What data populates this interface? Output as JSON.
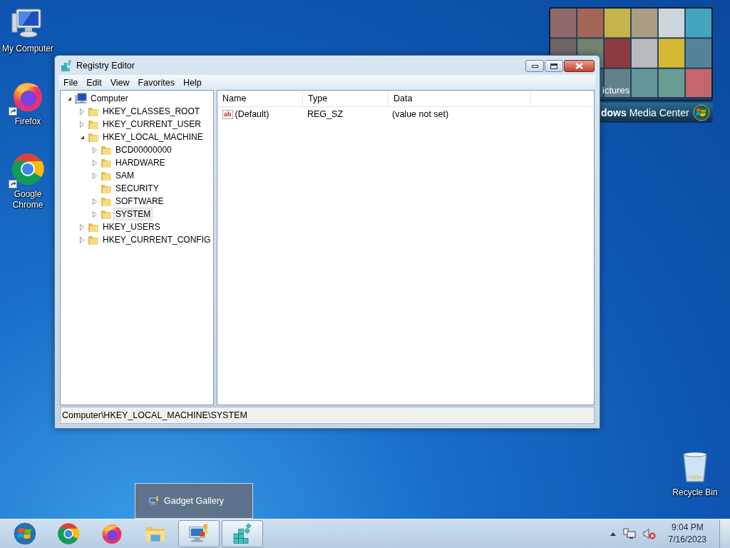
{
  "desktop_icons": [
    {
      "label": "My Computer",
      "kind": "computer",
      "shortcut": false
    },
    {
      "label": "Firefox",
      "kind": "firefox",
      "shortcut": true
    },
    {
      "label": "Google Chrome",
      "kind": "chrome",
      "shortcut": true
    },
    {
      "label": "Recycle Bin",
      "kind": "recycle",
      "shortcut": false
    }
  ],
  "media_center": {
    "caption": "ictures",
    "title": "**dows** Media Center"
  },
  "window": {
    "title": "Registry Editor",
    "menu": [
      "File",
      "Edit",
      "View",
      "Favorites",
      "Help"
    ],
    "tree": [
      {
        "label": "Computer",
        "kind": "computer",
        "expandable": true,
        "expanded": true,
        "selected": false,
        "children": [
          {
            "label": "HKEY_CLASSES_ROOT",
            "kind": "folder",
            "expandable": true,
            "expanded": false,
            "selected": false
          },
          {
            "label": "HKEY_CURRENT_USER",
            "kind": "folder",
            "expandable": true,
            "expanded": false,
            "selected": false
          },
          {
            "label": "HKEY_LOCAL_MACHINE",
            "kind": "folder",
            "expandable": true,
            "expanded": true,
            "selected": false,
            "children": [
              {
                "label": "BCD00000000",
                "kind": "folder",
                "expandable": true,
                "expanded": false,
                "selected": false
              },
              {
                "label": "HARDWARE",
                "kind": "folder",
                "expandable": true,
                "expanded": false,
                "selected": false
              },
              {
                "label": "SAM",
                "kind": "folder",
                "expandable": true,
                "expanded": false,
                "selected": false
              },
              {
                "label": "SECURITY",
                "kind": "folder",
                "expandable": false,
                "expanded": false,
                "selected": false
              },
              {
                "label": "SOFTWARE",
                "kind": "folder",
                "expandable": true,
                "expanded": false,
                "selected": false
              },
              {
                "label": "SYSTEM",
                "kind": "folder",
                "expandable": true,
                "expanded": false,
                "selected": true
              }
            ]
          },
          {
            "label": "HKEY_USERS",
            "kind": "folder",
            "expandable": true,
            "expanded": false,
            "selected": false
          },
          {
            "label": "HKEY_CURRENT_CONFIG",
            "kind": "folder",
            "expandable": true,
            "expanded": false,
            "selected": false
          }
        ]
      }
    ],
    "columns": [
      "Name",
      "Type",
      "Data"
    ],
    "rows": [
      {
        "icon_text": "ab",
        "name": "(Default)",
        "type": "REG_SZ",
        "data": "(value not set)"
      }
    ],
    "status_bar": "Computer\\HKEY_LOCAL_MACHINE\\SYSTEM"
  },
  "popup": {
    "label": "Gadget Gallery"
  },
  "taskbar": {
    "buttons": [
      {
        "kind": "chrome",
        "running": false
      },
      {
        "kind": "firefox",
        "running": false
      },
      {
        "kind": "explorer",
        "running": false
      },
      {
        "kind": "gadgets",
        "running": true
      },
      {
        "kind": "regedit",
        "running": true
      }
    ],
    "time": "9:04 PM",
    "date": "7/16/2023"
  }
}
